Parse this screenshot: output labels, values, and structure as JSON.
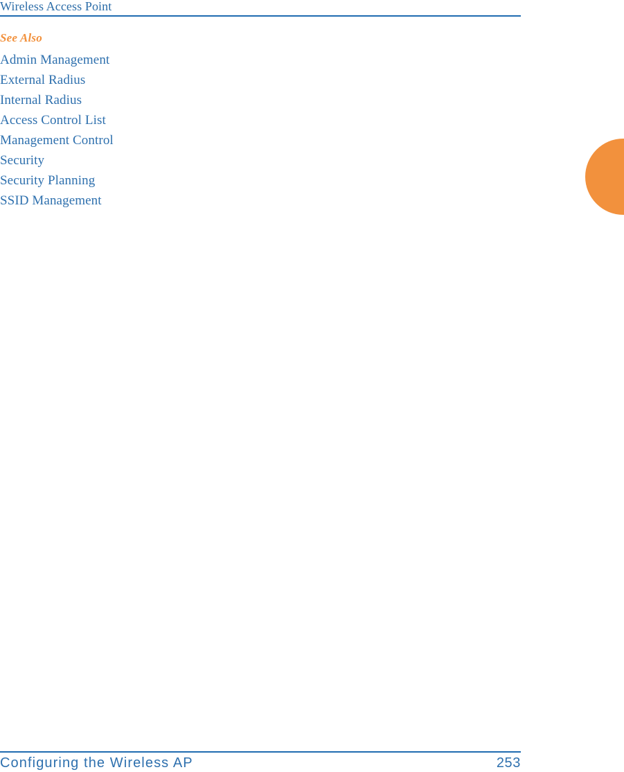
{
  "header": {
    "title": "Wireless Access Point",
    "rule_color": "#1F6BB0"
  },
  "content": {
    "see_also_heading": "See Also",
    "see_also_color": "#F2913D",
    "link_color": "#2E70AE",
    "links": [
      {
        "label": "Admin Management"
      },
      {
        "label": "External Radius"
      },
      {
        "label": "Internal Radius"
      },
      {
        "label": "Access Control List"
      },
      {
        "label": "Management Control"
      },
      {
        "label": "Security"
      },
      {
        "label": "Security Planning"
      },
      {
        "label": "SSID Management"
      }
    ]
  },
  "thumb_tab": {
    "color": "#F2913D"
  },
  "footer": {
    "chapter": "Configuring the Wireless AP",
    "page_number": "253",
    "rule_color": "#1F6BB0"
  }
}
